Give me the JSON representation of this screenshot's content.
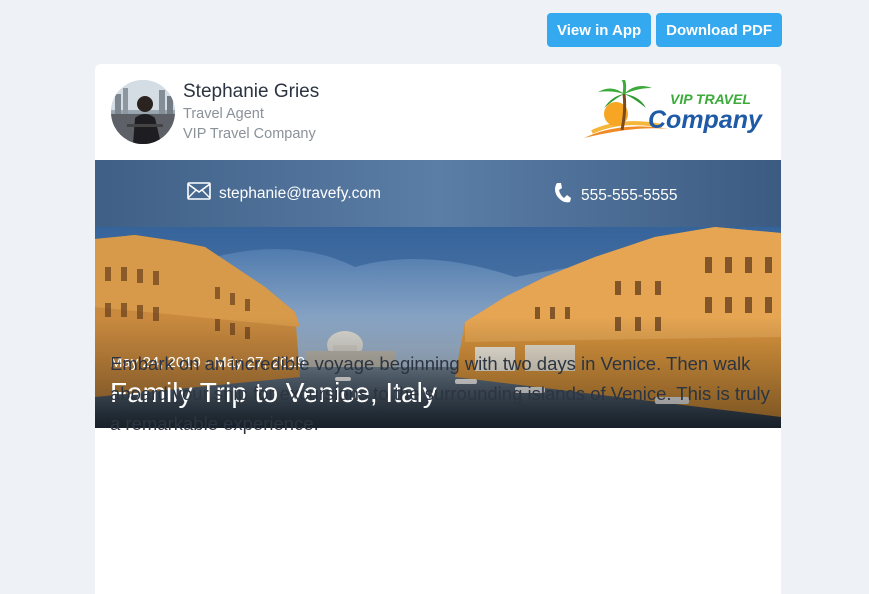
{
  "toolbar": {
    "view_in_app": "View in App",
    "download_pdf": "Download PDF"
  },
  "agent": {
    "name": "Stephanie Gries",
    "title": "Travel Agent",
    "company": "VIP Travel Company"
  },
  "logo": {
    "line1": "VIP TRAVEL",
    "line2": "Company"
  },
  "contact": {
    "email": "stephanie@travefy.com",
    "phone": "555-555-5555"
  },
  "trip": {
    "dates": "May 24, 2019 - May 27, 2019",
    "title": "Family Trip to Venice, Italy",
    "description": "Embark on an incredible voyage beginning with two days in Venice. Then walk aboard your ship for excursions to the surrounding islands of Venice. This is truly a remarkable experience."
  },
  "colors": {
    "accent": "#35a9ef",
    "contact_bar": "#4a6c93",
    "page_bg": "#eef2f7"
  }
}
